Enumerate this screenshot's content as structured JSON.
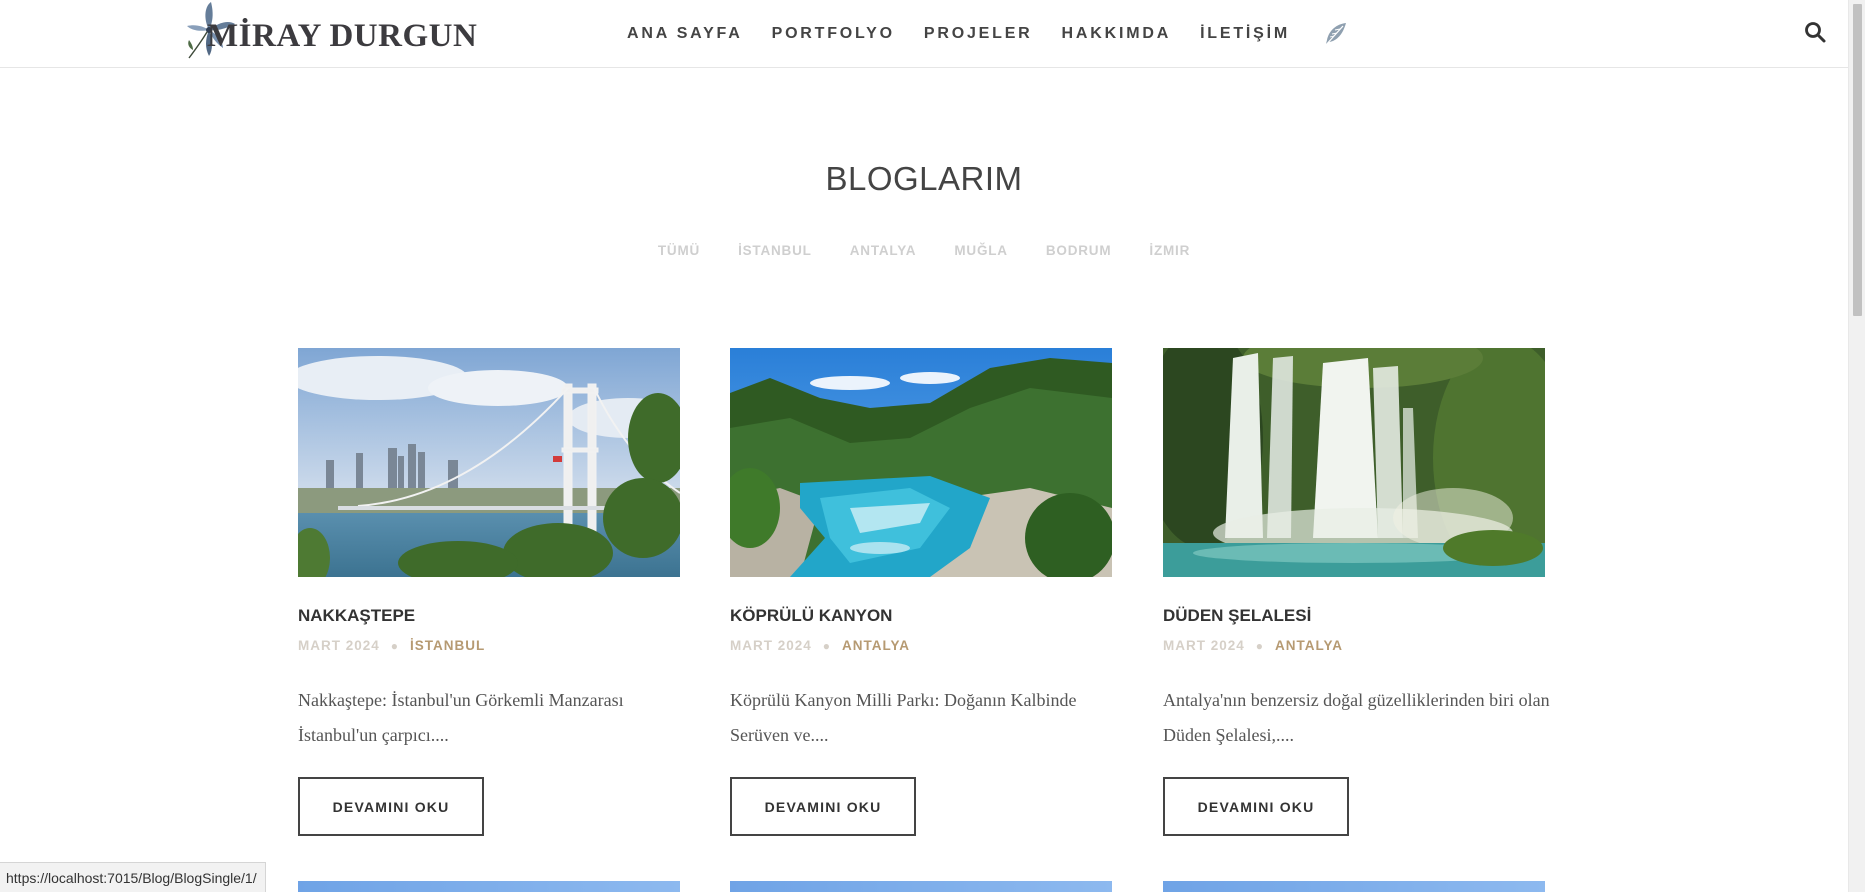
{
  "header": {
    "logo_text": "MİRAY DURGUN",
    "nav": [
      "ANA SAYFA",
      "PORTFOLYO",
      "PROJELER",
      "HAKKIMDA",
      "İLETİŞİM"
    ]
  },
  "page": {
    "title": "BLOGLARIM",
    "filters": [
      "TÜMÜ",
      "İSTANBUL",
      "ANTALYA",
      "MUĞLA",
      "BODRUM",
      "İZMIR"
    ]
  },
  "posts": [
    {
      "title": "NAKKAŞTEPE",
      "date": "MART 2024",
      "category": "İSTANBUL",
      "excerpt": "Nakkaştepe: İstanbul'un Görkemli Manzarası İstanbul'un çarpıcı....",
      "button": "DEVAMINI OKU",
      "image_icon": "bridge-photo"
    },
    {
      "title": "KÖPRÜLÜ KANYON",
      "date": "MART 2024",
      "category": "ANTALYA",
      "excerpt": "Köprülü Kanyon Milli Parkı: Doğanın Kalbinde Serüven ve....",
      "button": "DEVAMINI OKU",
      "image_icon": "canyon-river-photo"
    },
    {
      "title": "DÜDEN ŞELALESİ",
      "date": "MART 2024",
      "category": "ANTALYA",
      "excerpt": "Antalya'nın benzersiz doğal güzelliklerinden biri olan Düden Şelalesi,....",
      "button": "DEVAMINI OKU",
      "image_icon": "waterfall-photo"
    }
  ],
  "status_bar": {
    "url": "https://localhost:7015/Blog/BlogSingle/1/"
  },
  "colors": {
    "accent_category": "#b69a72",
    "meta_muted": "#d6d0c8",
    "filter_muted": "#cfcfcf"
  }
}
